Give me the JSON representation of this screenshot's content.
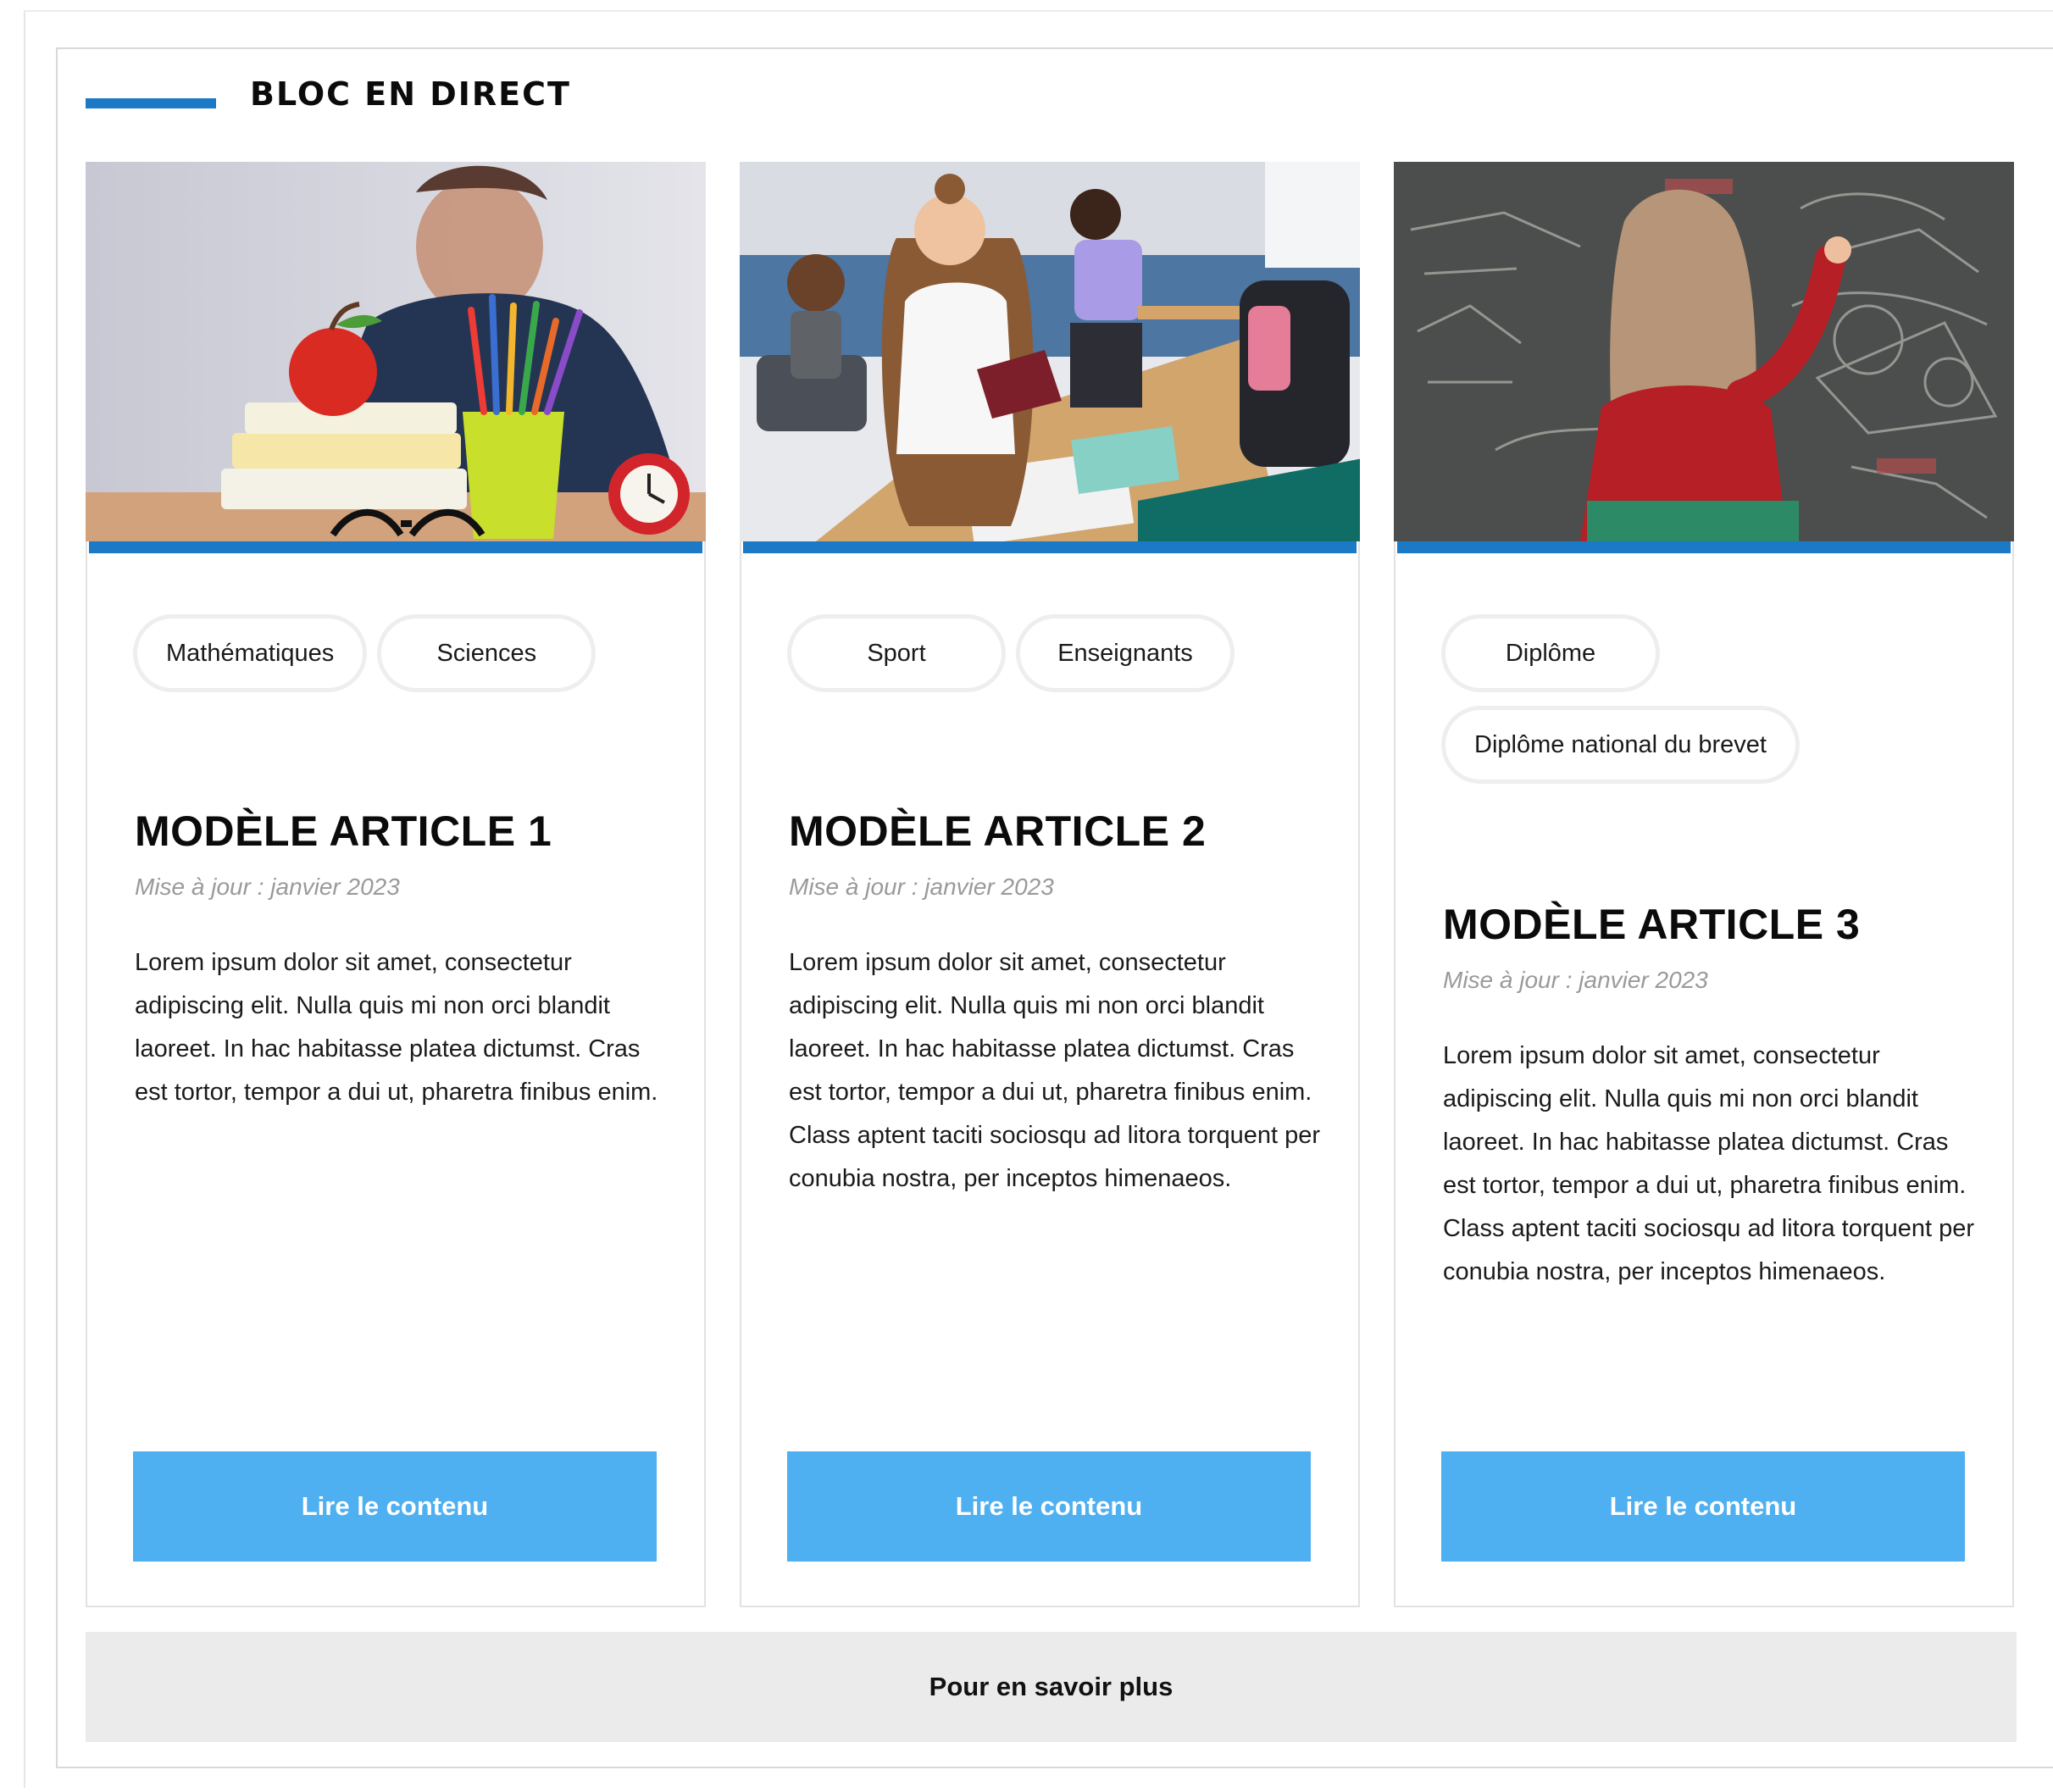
{
  "block": {
    "title": "BLOC EN DIRECT",
    "accent_color": "#1c79c6",
    "more_label": "Pour en savoir plus"
  },
  "cards": [
    {
      "image_icon": "school-supplies-photo",
      "tags": [
        "Mathématiques",
        "Sciences"
      ],
      "title": "MODÈLE ARTICLE 1",
      "date": "Mise à jour : janvier 2023",
      "text": "Lorem ipsum dolor sit amet, consectetur adipiscing elit. Nulla quis mi non orci blandit laoreet. In hac habitasse platea dictumst. Cras est tortor, tempor a dui ut, pharetra finibus enim.",
      "button": "Lire le contenu"
    },
    {
      "image_icon": "classroom-reading-photo",
      "tags": [
        "Sport",
        "Enseignants"
      ],
      "title": "MODÈLE ARTICLE 2",
      "date": "Mise à jour : janvier 2023",
      "text": "Lorem ipsum dolor sit amet, consectetur adipiscing elit. Nulla quis mi non orci blandit laoreet. In hac habitasse platea dictumst. Cras est tortor, tempor a dui ut, pharetra finibus enim. Class aptent taciti sociosqu ad litora torquent per conubia nostra, per inceptos himenaeos.",
      "button": "Lire le contenu"
    },
    {
      "image_icon": "chalkboard-writing-photo",
      "tags": [
        "Diplôme",
        "Diplôme national du brevet"
      ],
      "title": "MODÈLE ARTICLE 3",
      "date": "Mise à jour : janvier 2023",
      "text": "Lorem ipsum dolor sit amet, consectetur adipiscing elit. Nulla quis mi non orci blandit laoreet. In hac habitasse platea dictumst. Cras est tortor, tempor a dui ut, pharetra finibus enim. Class aptent taciti sociosqu ad litora torquent per conubia nostra, per inceptos himenaeos.",
      "button": "Lire le contenu"
    }
  ],
  "colors": {
    "button": "#4fb0f1",
    "more_button": "#ebebeb",
    "date": "#9a9a9a"
  }
}
